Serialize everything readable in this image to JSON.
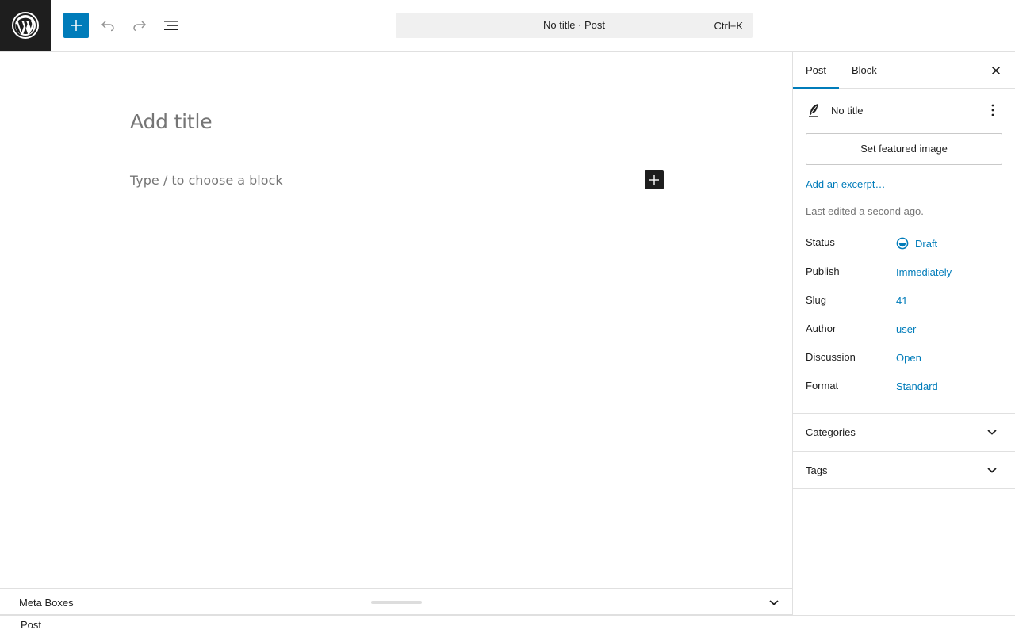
{
  "header": {
    "logo_icon": "wordpress-logo-icon",
    "inserter_icon": "plus-icon",
    "undo_icon": "undo-icon",
    "redo_icon": "redo-icon",
    "list_view_icon": "list-view-icon",
    "command_bar": {
      "title": "No title · Post",
      "shortcut": "Ctrl+K"
    }
  },
  "editor": {
    "title_placeholder": "Add title",
    "block_placeholder": "Type / to choose a block",
    "add_block_icon": "plus-icon"
  },
  "meta_boxes": {
    "label": "Meta Boxes",
    "toggle_icon": "chevron-down-icon"
  },
  "footer": {
    "breadcrumb": "Post"
  },
  "sidebar": {
    "tabs": [
      {
        "label": "Post",
        "active": true
      },
      {
        "label": "Block",
        "active": false
      }
    ],
    "close_icon": "close-icon",
    "post_card": {
      "icon": "post-feather-icon",
      "title": "No title",
      "more_icon": "more-vertical-icon"
    },
    "featured_image_button": "Set featured image",
    "excerpt_link": "Add an excerpt…",
    "last_edited": "Last edited a second ago.",
    "properties": [
      {
        "label": "Status",
        "value": "Draft",
        "icon": "draft-status-icon"
      },
      {
        "label": "Publish",
        "value": "Immediately"
      },
      {
        "label": "Slug",
        "value": "41"
      },
      {
        "label": "Author",
        "value": "user"
      },
      {
        "label": "Discussion",
        "value": "Open"
      },
      {
        "label": "Format",
        "value": "Standard"
      }
    ],
    "panels": [
      {
        "title": "Categories",
        "icon": "chevron-down-icon"
      },
      {
        "title": "Tags",
        "icon": "chevron-down-icon"
      }
    ]
  },
  "colors": {
    "accent": "#007cba",
    "dark": "#1e1e1e",
    "muted": "#757575",
    "border": "#e0e0e0"
  }
}
